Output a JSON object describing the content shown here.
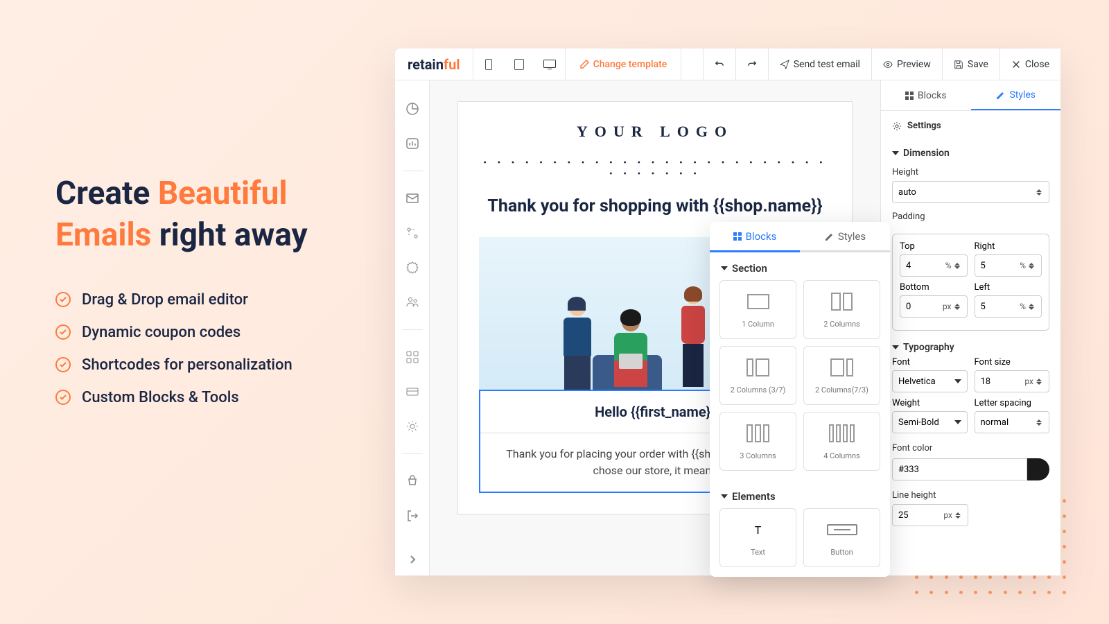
{
  "hero": {
    "line1_a": "Create ",
    "line1_b": "Beautiful",
    "line2_a": "Emails",
    "line2_b": " right away",
    "features": [
      "Drag & Drop email editor",
      "Dynamic coupon codes",
      "Shortcodes for personalization",
      "Custom Blocks & Tools"
    ]
  },
  "logo": {
    "part1": "retain",
    "part2": "ful"
  },
  "toolbar": {
    "change_template": "Change template",
    "send_test": "Send test email",
    "preview": "Preview",
    "save": "Save",
    "close": "Close"
  },
  "email": {
    "logo_text": "YOUR LOGO",
    "heading": "Thank you for shopping with {{shop.name}}",
    "hello": "Hello {{first_name}}",
    "body": "Thank you for placing your order with {{shop.name}} that you chose our store, it means"
  },
  "popup": {
    "tabs": {
      "blocks": "Blocks",
      "styles": "Styles"
    },
    "section_label": "Section",
    "elements_label": "Elements",
    "cards": {
      "c1": "1 Column",
      "c2": "2 Columns",
      "c37": "2 Columns (3/7)",
      "c73": "2 Columns(7/3)",
      "c3": "3 Columns",
      "c4": "4 Columns",
      "text": "Text",
      "button": "Button"
    }
  },
  "panel": {
    "tabs": {
      "blocks": "Blocks",
      "styles": "Styles"
    },
    "settings": "Settings",
    "dimension": "Dimension",
    "height_label": "Height",
    "height_value": "auto",
    "padding_label": "Padding",
    "padding": {
      "top_l": "Top",
      "top_v": "4",
      "top_u": "%",
      "right_l": "Right",
      "right_v": "5",
      "right_u": "%",
      "bottom_l": "Bottom",
      "bottom_v": "0",
      "bottom_u": "px",
      "left_l": "Left",
      "left_v": "5",
      "left_u": "%"
    },
    "typography": "Typography",
    "font_l": "Font",
    "font_v": "Helvetica",
    "fontsize_l": "Font size",
    "fontsize_v": "18",
    "fontsize_u": "px",
    "weight_l": "Weight",
    "weight_v": "Semi-Bold",
    "letter_l": "Letter spacing",
    "letter_v": "normal",
    "color_l": "Font color",
    "color_v": "#333",
    "lineheight_l": "Line height",
    "lineheight_v": "25",
    "lineheight_u": "px"
  }
}
